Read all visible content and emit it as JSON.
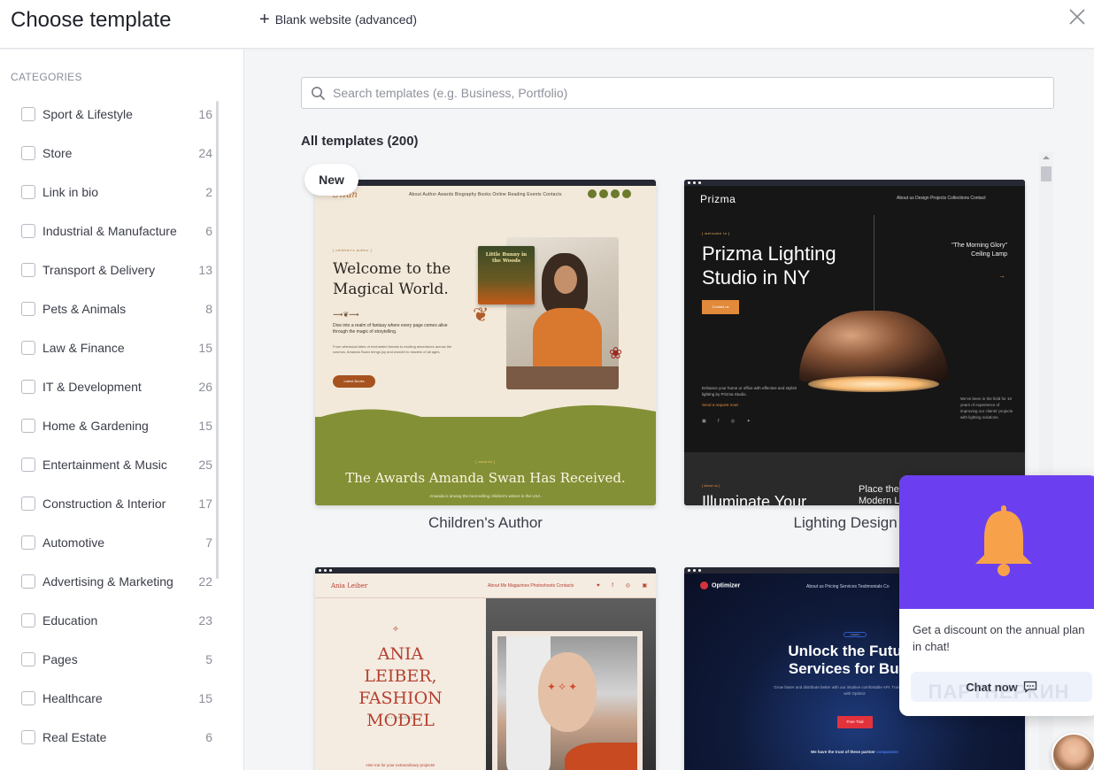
{
  "header": {
    "title": "Choose template",
    "blank_label": "Blank website (advanced)"
  },
  "sidebar": {
    "title": "CATEGORIES",
    "items": [
      {
        "label": "Sport & Lifestyle",
        "count": "16"
      },
      {
        "label": "Store",
        "count": "24"
      },
      {
        "label": "Link in bio",
        "count": "2"
      },
      {
        "label": "Industrial & Manufacture",
        "count": "6"
      },
      {
        "label": "Transport & Delivery",
        "count": "13"
      },
      {
        "label": "Pets & Animals",
        "count": "8"
      },
      {
        "label": "Law & Finance",
        "count": "15"
      },
      {
        "label": "IT & Development",
        "count": "26"
      },
      {
        "label": "Home & Gardening",
        "count": "15"
      },
      {
        "label": "Entertainment & Music",
        "count": "25"
      },
      {
        "label": "Construction & Interior",
        "count": "17"
      },
      {
        "label": "Automotive",
        "count": "7"
      },
      {
        "label": "Advertising & Marketing",
        "count": "22"
      },
      {
        "label": "Education",
        "count": "23"
      },
      {
        "label": "Pages",
        "count": "5"
      },
      {
        "label": "Healthcare",
        "count": "15"
      },
      {
        "label": "Real Estate",
        "count": "6"
      }
    ]
  },
  "search": {
    "placeholder": "Search templates (e.g. Business, Portfolio)"
  },
  "main": {
    "all_templates": "All templates (200)",
    "new_badge": "New",
    "cards": [
      {
        "caption": "Children's Author",
        "logo": "Swan",
        "nav": "About Author   Awards   Biography   Books   Online Reading   Events   Contacts",
        "kicker": "[ children's author ]",
        "hero_title": "Welcome to the Magical World.",
        "ornament": "⟿❦⟿",
        "desc": "Dive into a realm of fantasy where every page comes alive through the magic of storytelling.",
        "desc2": "From whimsical tales of enchanted forests to exciting adventures across the cosmos, Amanda Swan brings joy and wonder to readers of all ages.",
        "button": "Latest Books",
        "book_title": "Little Bunny in the Woods",
        "awards_kicker": "[ awards ]",
        "awards_title": "The Awards Amanda Swan Has Received.",
        "awards_sub": "Amanda is among the best-selling children's writers in the USA."
      },
      {
        "caption": "Lighting Design St",
        "logo": "Prizma",
        "nav": "About us    Design    Projects    Collections    Contact",
        "kicker": "[ welcome to ]",
        "hero_title": "Prizma Lighting Studio in NY",
        "button": "Contact us",
        "product": "\"The Morning Glory\" Ceiling Lamp",
        "arrow": "→",
        "desc": "Enhance your home or office with effective and stylish lighting by Prizma Studio.",
        "request": "Send a request now!",
        "socials": "▣ f ◎ ✦",
        "side_text": "We've been in the field for 10 years of experience of improving our clients' projects with lighting solutions.",
        "lower_kicker": "[ about us ]",
        "lower_title": "Illuminate Your",
        "lower_right": "Place the Modern Li"
      },
      {
        "logo": "Ania Leiber",
        "nav": "About Me   Magazines   Photoshoots   Contacts",
        "socials": "♥ f ◎ ▣",
        "ornament": "⟡",
        "name": "ANIA LEIBER, FASHION MODEL",
        "by": "BY I. RIBLOVICH",
        "hire": "Hire me for your extraordinary projects!"
      },
      {
        "logo": "Optimizer",
        "nav": "About us    Pricing    Services    Testimonials    Co",
        "pill": "[ SaaS ]",
        "hero_title": "Unlock the Future: Services for Busin",
        "desc": "Grow faster and distribute better with our intuitive comfortable API. Transform your business with Optimiz",
        "button": "Free Trial",
        "trust": "We have the trust of these partner",
        "trust_link": "companies!"
      }
    ]
  },
  "popup": {
    "message": "Get a discount on the annual plan in chat!",
    "chat_label": "Chat now",
    "watermark": "ПАРТНЕРКИН"
  },
  "colors": {
    "popup_purple": "#6b3ff0",
    "bell_orange": "#f7a24a",
    "accent_red": "#e2323c"
  }
}
